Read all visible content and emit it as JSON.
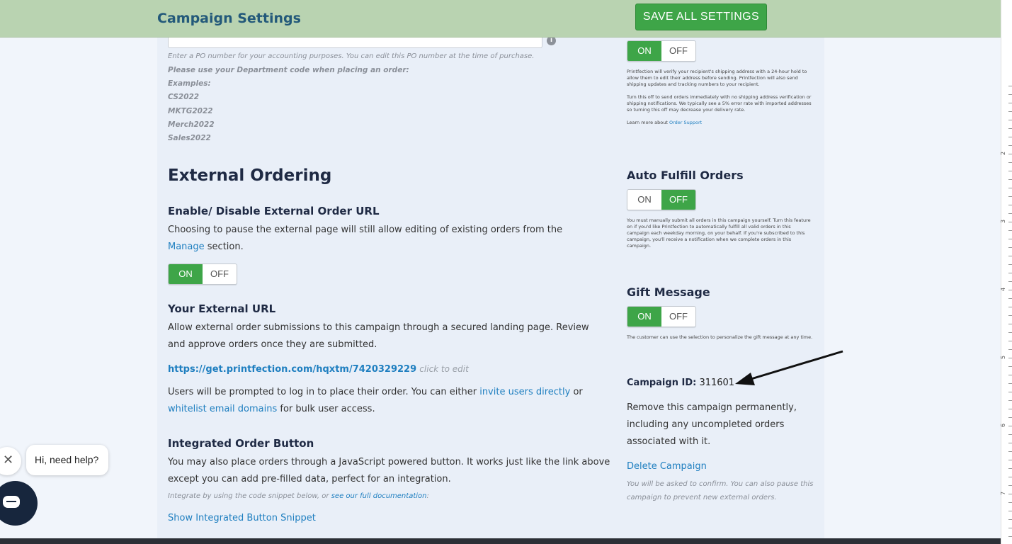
{
  "header": {
    "title": "Campaign Settings",
    "save_label": "SAVE ALL SETTINGS"
  },
  "po": {
    "help": "Enter a PO number for your accounting purposes. You can edit this PO number at the time of purchase.",
    "dept_note": "Please use your Department code when placing an order:",
    "examples_label": "Examples:",
    "examples": [
      "CS2022",
      "MKTG2022",
      "Merch2022",
      "Sales2022"
    ]
  },
  "external": {
    "heading": "External Ordering",
    "enable_heading": "Enable/ Disable External Order URL",
    "enable_text_1": "Choosing to pause the external page will still allow editing of existing orders from the",
    "enable_link": "Manage",
    "enable_text_2": "section.",
    "url_heading": "Your External URL",
    "url_text_1": "Allow external order submissions to this campaign through a secured landing page. Review",
    "url_text_2": "and approve orders once they are submitted.",
    "url": "https://get.printfection.com/hqxtm/7420329229",
    "click_to_edit": "click to edit",
    "users_text_1": "Users will be prompted to log in to place their order. You can either",
    "users_link_1": "invite users directly",
    "users_text_2": "or",
    "users_link_2": "whitelist email domains",
    "users_text_3": "for bulk user access.",
    "button_heading": "Integrated Order Button",
    "button_text_1": "You may also place orders through a JavaScript powered button. It works just like the link above",
    "button_text_2": "except you can add pre-filled data, perfect for an integration.",
    "integrate_text": "Integrate by using the code snippet below, or",
    "integrate_link": "see our full documentation",
    "integrate_colon": ":",
    "show_snippet": "Show Integrated Button Snippet"
  },
  "toggles": {
    "on": "ON",
    "off": "OFF"
  },
  "support": {
    "p1": "Printfection will verify your recipient's shipping address with a 24-hour hold to allow them to edit their address before sending. Printfection will also send shipping updates and tracking numbers to your recipient.",
    "p2": "Turn this off to send orders immediately with no shipping address verification or shipping notifications. We typically see a 5% error rate with imported addresses so turning this off may decrease your delivery rate.",
    "p3_text": "Learn more about",
    "p3_link": "Order Support"
  },
  "auto_fulfill": {
    "heading": "Auto Fulfill Orders",
    "text": "You must manually submit all orders in this campaign yourself. Turn this feature on if you'd like Printfection to automatically fulfill all valid orders in this campaign each weekday morning, on your behalf. If you're subscribed to this campaign, you'll receive a notification when we complete orders in this campaign."
  },
  "gift": {
    "heading": "Gift Message",
    "text": "The customer can use the selection to personalize the gift message at any time."
  },
  "campaign": {
    "id_label": "Campaign ID:",
    "id_value": "311601",
    "remove_1": "Remove this campaign permanently,",
    "remove_2": "including any uncompleted orders",
    "remove_3": "associated with it.",
    "delete_link": "Delete Campaign",
    "confirm_1": "You will be asked to confirm. You can also pause this",
    "confirm_2": "campaign to prevent new external orders."
  },
  "chat": {
    "bubble": "Hi, need help?"
  },
  "ruler": {
    "labels": [
      "2",
      "3",
      "4",
      "5",
      "6",
      "7"
    ]
  }
}
